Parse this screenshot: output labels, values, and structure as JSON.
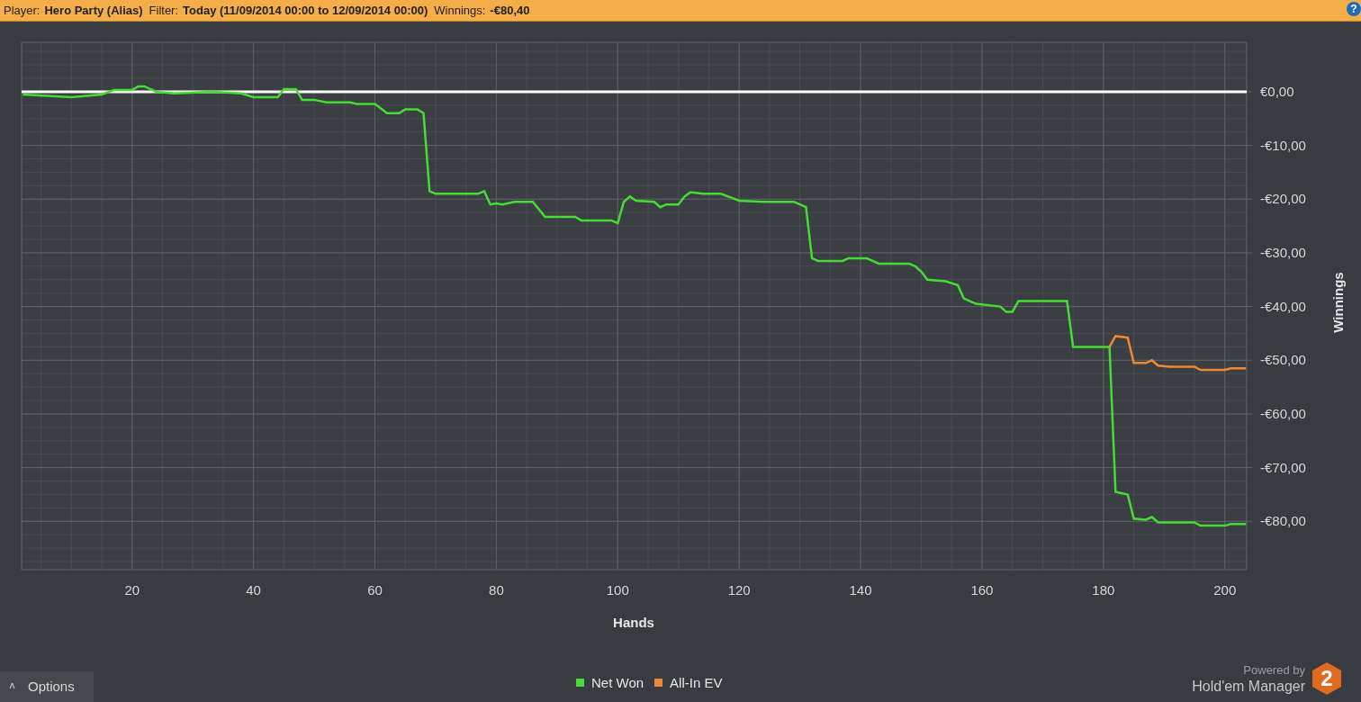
{
  "filter_bar": {
    "player_label": "Player:",
    "player": "Hero Party (Alias)",
    "filter_label": "Filter:",
    "filter": "Today (11/09/2014 00:00 to 12/09/2014 00:00)",
    "winnings_label": "Winnings:",
    "winnings": "-€80,40",
    "help": "?"
  },
  "graph": {
    "chart_data": {
      "type": "line",
      "xlabel": "Hands",
      "ylabel": "Winnings",
      "xlim": [
        1.8,
        203.6
      ],
      "ylim": [
        -89,
        9.2
      ],
      "xticks": [
        20,
        40,
        60,
        80,
        100,
        120,
        140,
        160,
        180,
        200
      ],
      "yticks": [
        {
          "value": 0,
          "label": "€0,00"
        },
        {
          "value": -10,
          "label": "-€10,00"
        },
        {
          "value": -20,
          "label": "-€20,00"
        },
        {
          "value": -30,
          "label": "-€30,00"
        },
        {
          "value": -40,
          "label": "-€40,00"
        },
        {
          "value": -50,
          "label": "-€50,00"
        },
        {
          "value": -60,
          "label": "-€60,00"
        },
        {
          "value": -70,
          "label": "-€70,00"
        },
        {
          "value": -80,
          "label": "-€80,00"
        }
      ],
      "x": [
        2,
        10,
        15,
        17,
        20,
        21,
        22,
        24,
        27,
        33,
        38,
        40,
        44,
        45,
        47,
        48,
        50,
        52,
        56,
        57,
        60,
        62,
        64,
        65,
        67,
        68,
        69,
        70,
        77,
        78,
        79,
        80,
        81,
        83,
        86,
        88,
        93,
        94,
        99,
        100,
        101,
        102,
        103,
        106,
        107,
        108,
        110,
        111,
        112,
        114,
        117,
        120,
        124,
        129,
        131,
        132,
        133,
        137,
        138,
        141,
        143,
        148,
        149,
        150,
        151,
        154,
        156,
        157,
        159,
        163,
        164,
        165,
        166,
        174,
        175,
        181,
        182,
        184,
        185,
        187,
        188,
        189,
        191,
        195,
        196,
        200,
        201,
        203.5
      ],
      "series": [
        {
          "name": "Net Won",
          "color": "#44dd33",
          "values": [
            -0.5,
            -1,
            -0.5,
            0.3,
            0.3,
            1,
            1,
            0,
            -0.3,
            0,
            -0.3,
            -1,
            -1,
            0.5,
            0.5,
            -1.5,
            -1.5,
            -2,
            -2,
            -2.3,
            -2.3,
            -4,
            -4,
            -3.3,
            -3.3,
            -4,
            -18.5,
            -19,
            -19,
            -18.5,
            -21,
            -20.8,
            -21,
            -20.5,
            -20.5,
            -23.3,
            -23.3,
            -24,
            -24,
            -24.5,
            -20.5,
            -19.5,
            -20.3,
            -20.5,
            -21.5,
            -21,
            -21,
            -19.5,
            -18.7,
            -19,
            -19,
            -20.3,
            -20.5,
            -20.5,
            -21.5,
            -31,
            -31.5,
            -31.5,
            -31,
            -31,
            -32,
            -32,
            -32.5,
            -33.5,
            -35,
            -35.3,
            -36,
            -38.5,
            -39.5,
            -40,
            -41,
            -41,
            -39,
            -39,
            -47.5,
            -47.5,
            -74.5,
            -75,
            -79.5,
            -79.7,
            -79.2,
            -80.2,
            -80.2,
            -80.2,
            -80.8,
            -80.8,
            -80.5,
            -80.5
          ]
        },
        {
          "name": "All-In EV",
          "color": "#ee8833",
          "values": [
            null,
            null,
            null,
            null,
            null,
            null,
            null,
            null,
            null,
            null,
            null,
            null,
            null,
            null,
            null,
            null,
            null,
            null,
            null,
            null,
            null,
            null,
            null,
            null,
            null,
            null,
            null,
            null,
            null,
            null,
            null,
            null,
            null,
            null,
            null,
            null,
            null,
            null,
            null,
            null,
            null,
            null,
            null,
            null,
            null,
            null,
            null,
            null,
            null,
            null,
            null,
            null,
            null,
            null,
            null,
            null,
            null,
            null,
            null,
            null,
            null,
            null,
            null,
            null,
            null,
            null,
            null,
            null,
            null,
            null,
            null,
            null,
            null,
            null,
            null,
            -47.5,
            -45.5,
            -45.8,
            -50.5,
            -50.5,
            -50,
            -51,
            -51.2,
            -51.2,
            -51.8,
            -51.8,
            -51.5,
            -51.5
          ]
        }
      ],
      "grid": true,
      "ref_lines": [
        {
          "axis": "y",
          "value": 0
        }
      ]
    }
  },
  "options_button": {
    "caret": "˄",
    "label": "Options"
  },
  "branding": {
    "powered_by": "Powered by",
    "product": "Hold'em Manager",
    "badge": "2"
  }
}
